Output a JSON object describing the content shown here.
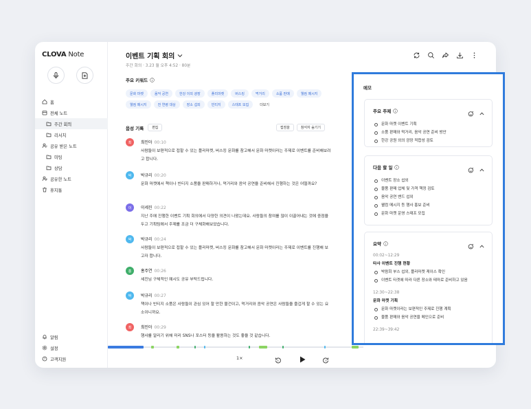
{
  "sidebar": {
    "logo_bold": "CLOVA",
    "logo_rest": " Note",
    "items": [
      {
        "label": "홈",
        "icon": "home-icon"
      },
      {
        "label": "전체 노트",
        "icon": "notes-icon"
      },
      {
        "label": "주간 회의",
        "icon": "folder-icon",
        "sub": true,
        "active": true
      },
      {
        "label": "리서치",
        "icon": "folder-icon",
        "sub": true
      },
      {
        "label": "공유 받은 노트",
        "icon": "shared-user-icon"
      },
      {
        "label": "미팅",
        "icon": "folder-icon",
        "sub": true
      },
      {
        "label": "상담",
        "icon": "folder-icon",
        "sub": true
      },
      {
        "label": "공유한 노트",
        "icon": "share-user-icon"
      },
      {
        "label": "휴지통",
        "icon": "trash-icon"
      }
    ],
    "bottom_items": [
      {
        "label": "알림",
        "icon": "bell-icon"
      },
      {
        "label": "설정",
        "icon": "gear-icon"
      },
      {
        "label": "고객지원",
        "icon": "help-icon"
      }
    ]
  },
  "note": {
    "title": "이벤트 기획 회의",
    "meta": "주간 회의 · 3.23 월 오후 4:52 · 80분"
  },
  "keywords": {
    "title": "주요 키워드",
    "chips": [
      "문화 마켓",
      "음악 공연",
      "한강 이외 광장",
      "플리마켓",
      "버스킹",
      "먹거리",
      "소품 판매",
      "웰컴 메시지",
      "웰컴 메시지",
      "전 연령 대상",
      "장소 섭외",
      "빈티지",
      "스태프 모집"
    ],
    "more": "더보기"
  },
  "recording": {
    "title": "음성 기록",
    "edit": "편집",
    "bookmark": "접점을",
    "hide": "참석자 숨기기",
    "utterances": [
      {
        "initial": "최",
        "speaker": "최민아",
        "time": "00:10",
        "color": "#f06262",
        "text": "사람들이 보편적으로 접할 수 있는 플리마켓, 버스킹 문화를 참고해서 문화 마켓이라는 주제로 이벤트를 준비해보려고 합니다."
      },
      {
        "initial": "박",
        "speaker": "박규리",
        "time": "00:20",
        "color": "#4fb8ee",
        "text": "문화 마켓에서 책이나 빈티지 소품을 판매하거나, 먹거리와 음악 공연을 준비해서 진행하는 것은 어떨까요?"
      },
      {
        "initial": "이",
        "speaker": "이세진",
        "time": "00:22",
        "color": "#7b6ee8",
        "text": "지난 주에 진행한 이벤트 기획 회의에서 다양한 의견이 나왔는데요. 사람들의 참여를 많이 이끌어내는 것에 중점을 두고 기획팀에서 주제를 조금 더 구체화해보았습니다."
      },
      {
        "initial": "박",
        "speaker": "박규리",
        "time": "00:24",
        "color": "#4fb8ee",
        "text": "사람들이 보편적으로 접할 수 있는 플리마켓, 버스킹 문화를 참고해서 문화 마켓이라는 주제로 이벤트를 진행해 보고자 합니다."
      },
      {
        "initial": "홍",
        "speaker": "홍주연",
        "time": "00:26",
        "color": "#3fae6a",
        "text": "세진님 구체적인 예시도 공유 부탁드립니다."
      },
      {
        "initial": "박",
        "speaker": "박규리",
        "time": "00:27",
        "color": "#4fb8ee",
        "text": "책이나 빈티지 소품은 사람들이 관심 있어 할 만한 물건이고, 먹거리와 음악 공연은 사람들을 즐겁게 할 수 있는 요소이니까요."
      },
      {
        "initial": "최",
        "speaker": "최민아",
        "time": "00:29",
        "color": "#f06262",
        "text": "행사를 알리기 위해 미리 SNS나 포스터 등을 활용하는 것도 좋을 것 같습니다."
      }
    ]
  },
  "player": {
    "speed": "1×",
    "progress": 0.14
  },
  "memo": {
    "title": "메모",
    "topics": {
      "title": "주요 주제",
      "items": [
        "문화 마켓 이벤트 기획",
        "소품 판매와 먹거리, 음악 공연 준비 방안",
        "한강 공원 외의 광장 적합성 검토"
      ]
    },
    "todo": {
      "title": "다음 할 일",
      "items": [
        "이벤트 장소 섭외",
        "물품 판매 업체 및 가격 책정 검토",
        "음악 공연 밴드 섭외",
        "웰컴 메시지 등 행사 홍보 준비",
        "문화 마켓 운영 스태프 모집"
      ]
    },
    "summary": {
      "title": "요약",
      "sections": [
        {
          "time": "00:02~12:29",
          "head": "타사 이벤트 진행 현황",
          "items": [
            "박람회 부스 섭외, 플리마켓 케이스 확인",
            "이벤트 타겟에 따라 다른 장소와 테마로 준비하고 있음"
          ]
        },
        {
          "time": "12:30~22:38",
          "head": "문화 마켓 기획",
          "items": [
            "문화 마켓이라는 보편적인 주제로 진행 계획",
            "물품 판매와 음악 공연을 메인으로 준비"
          ]
        }
      ],
      "last_time": "22:39~39:42"
    }
  }
}
